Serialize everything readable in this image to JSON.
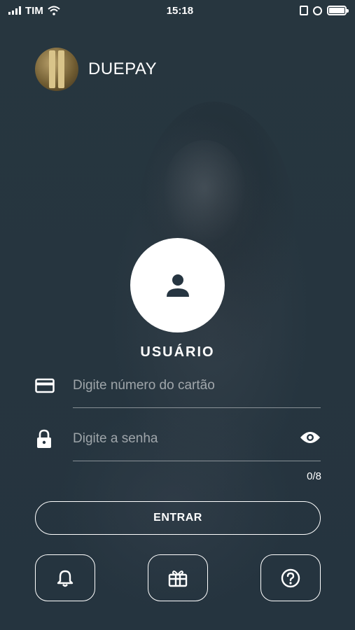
{
  "status_bar": {
    "carrier": "TIM",
    "time": "15:18"
  },
  "brand": {
    "name": "DUEPAY",
    "logo_icon": "duepay-logo"
  },
  "login": {
    "title": "USUÁRIO",
    "card_placeholder": "Digite número do cartão",
    "password_placeholder": "Digite a senha",
    "password_counter": "0/8",
    "submit_label": "ENTRAR"
  },
  "bottom_actions": [
    {
      "icon": "bell-icon"
    },
    {
      "icon": "gift-icon"
    },
    {
      "icon": "help-icon"
    }
  ]
}
